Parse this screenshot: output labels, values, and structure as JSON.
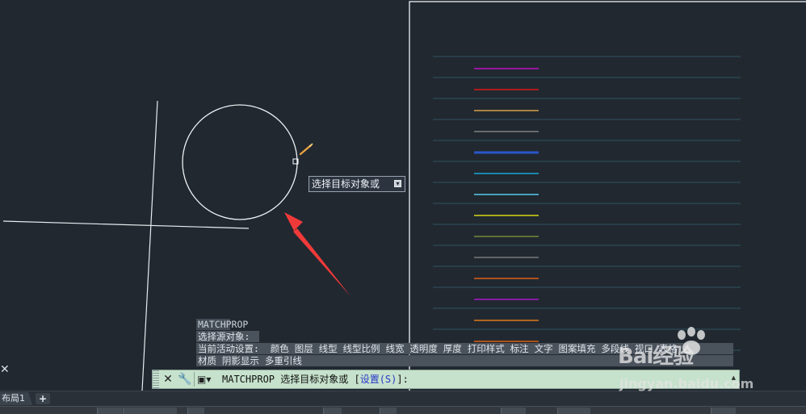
{
  "tooltip": {
    "label": "选择目标对象或"
  },
  "command_history": {
    "line1": "MATCHPROP",
    "line2": "选择源对象:",
    "line3": "当前活动设置:  颜色 图层 线型 线型比例 线宽 透明度 厚度 打印样式 标注 文字 图案填充 多段线 视口 表格",
    "line4": "材质 阴影显示 多重引线"
  },
  "command_line": {
    "prefix": "MATCHPROP 选择目标对象或 [",
    "option": "设置(S)",
    "suffix": "]:",
    "icons": [
      "close-icon",
      "wrench-icon",
      "command-prompt-icon"
    ]
  },
  "tabs": {
    "layout_label": "布局1",
    "add_label": "+"
  },
  "linetype_colors": [
    "#c010c8",
    "#d81818",
    "#d8a048",
    "#808080",
    "#2a56c8",
    "#18a8d8",
    "#58c8e8",
    "#d8d818",
    "#788838",
    "#787878",
    "#e06018",
    "#a818c8",
    "#e07818",
    "#d86010"
  ],
  "watermark": {
    "brand": "Bai经验",
    "url": "jingyan.baidu.com"
  },
  "colors": {
    "background": "#212830",
    "command_bar": "#c6e2cc",
    "annotation_arrow": "#f03a3a"
  }
}
